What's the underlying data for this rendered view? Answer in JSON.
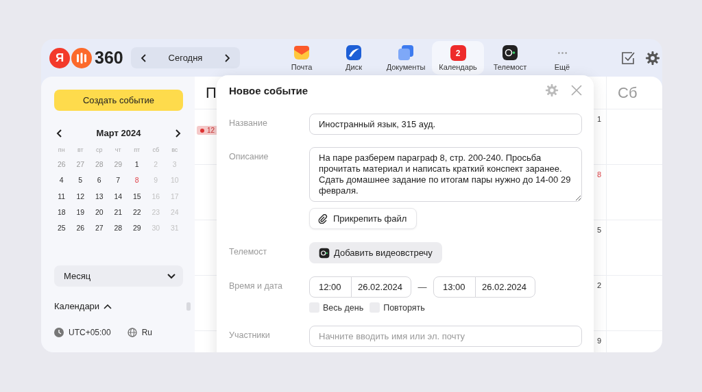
{
  "logo": {
    "letter": "Я",
    "text": "360"
  },
  "nav": {
    "today": "Сегодня"
  },
  "services": [
    {
      "kind": "mail",
      "label": "Почта",
      "selected": false
    },
    {
      "kind": "disk",
      "label": "Диск",
      "selected": false
    },
    {
      "kind": "docs",
      "label": "Документы",
      "selected": false
    },
    {
      "kind": "calendar",
      "label": "Календарь",
      "badge": "2",
      "selected": true
    },
    {
      "kind": "telemost",
      "label": "Телемост",
      "selected": false
    },
    {
      "kind": "more",
      "label": "Ещё",
      "selected": false
    }
  ],
  "sidebar": {
    "create_button": "Создать событие",
    "mini_calendar": {
      "title": "Март 2024",
      "weekdays": [
        "пн",
        "вт",
        "ср",
        "чт",
        "пт",
        "сб",
        "вс"
      ],
      "weeks": [
        [
          {
            "day": "26",
            "kind": "other"
          },
          {
            "day": "27",
            "kind": "other"
          },
          {
            "day": "28",
            "kind": "other"
          },
          {
            "day": "29",
            "kind": "other"
          },
          {
            "day": "1",
            "kind": "day"
          },
          {
            "day": "2",
            "kind": "weekend"
          },
          {
            "day": "3",
            "kind": "weekend"
          }
        ],
        [
          {
            "day": "4",
            "kind": "day"
          },
          {
            "day": "5",
            "kind": "day"
          },
          {
            "day": "6",
            "kind": "day"
          },
          {
            "day": "7",
            "kind": "day"
          },
          {
            "day": "8",
            "kind": "holiday"
          },
          {
            "day": "9",
            "kind": "weekend"
          },
          {
            "day": "10",
            "kind": "weekend"
          }
        ],
        [
          {
            "day": "11",
            "kind": "day"
          },
          {
            "day": "12",
            "kind": "day"
          },
          {
            "day": "13",
            "kind": "day"
          },
          {
            "day": "14",
            "kind": "day"
          },
          {
            "day": "15",
            "kind": "day"
          },
          {
            "day": "16",
            "kind": "weekend"
          },
          {
            "day": "17",
            "kind": "weekend"
          }
        ],
        [
          {
            "day": "18",
            "kind": "day"
          },
          {
            "day": "19",
            "kind": "day"
          },
          {
            "day": "20",
            "kind": "day"
          },
          {
            "day": "21",
            "kind": "day"
          },
          {
            "day": "22",
            "kind": "day"
          },
          {
            "day": "23",
            "kind": "weekend"
          },
          {
            "day": "24",
            "kind": "weekend"
          }
        ],
        [
          {
            "day": "25",
            "kind": "day"
          },
          {
            "day": "26",
            "kind": "day"
          },
          {
            "day": "27",
            "kind": "day"
          },
          {
            "day": "28",
            "kind": "day"
          },
          {
            "day": "29",
            "kind": "day"
          },
          {
            "day": "30",
            "kind": "weekend"
          },
          {
            "day": "31",
            "kind": "weekend"
          }
        ]
      ]
    },
    "view_select": {
      "value": "Месяц"
    },
    "calendars": {
      "label": "Календари",
      "expanded": true
    },
    "timezone": "UTC+05:00",
    "language": "Ru"
  },
  "calendar": {
    "first_header": "П",
    "saturday_header": "Сб",
    "event_chip": "12",
    "day_numbers": [
      {
        "text": "1",
        "holiday": false
      },
      {
        "text": "8",
        "holiday": true
      },
      {
        "text": "5",
        "holiday": false
      },
      {
        "text": "2",
        "holiday": false
      },
      {
        "text": "9",
        "holiday": false
      }
    ]
  },
  "dialog": {
    "title": "Новое событие",
    "name": {
      "label": "Название",
      "value": "Иностранный язык, 315 ауд."
    },
    "description": {
      "label": "Описание",
      "value": "На паре разберем параграф 8, стр. 200-240. Просьба прочитать материал и написать краткий конспект заранее. Сдать домашнее задание по итогам пары нужно до 14-00 29 февраля."
    },
    "attach_button": "Прикрепить файл",
    "telemost": {
      "label": "Телемост",
      "button": "Добавить видеовстречу"
    },
    "datetime": {
      "label": "Время и дата",
      "start_time": "12:00",
      "start_date": "26.02.2024",
      "separator": "—",
      "end_time": "13:00",
      "end_date": "26.02.2024"
    },
    "options": [
      {
        "label": "Весь день",
        "checked": false
      },
      {
        "label": "Повторять",
        "checked": false
      }
    ],
    "participants": {
      "label": "Участники",
      "placeholder": "Начните вводить имя или эл. почту"
    }
  }
}
